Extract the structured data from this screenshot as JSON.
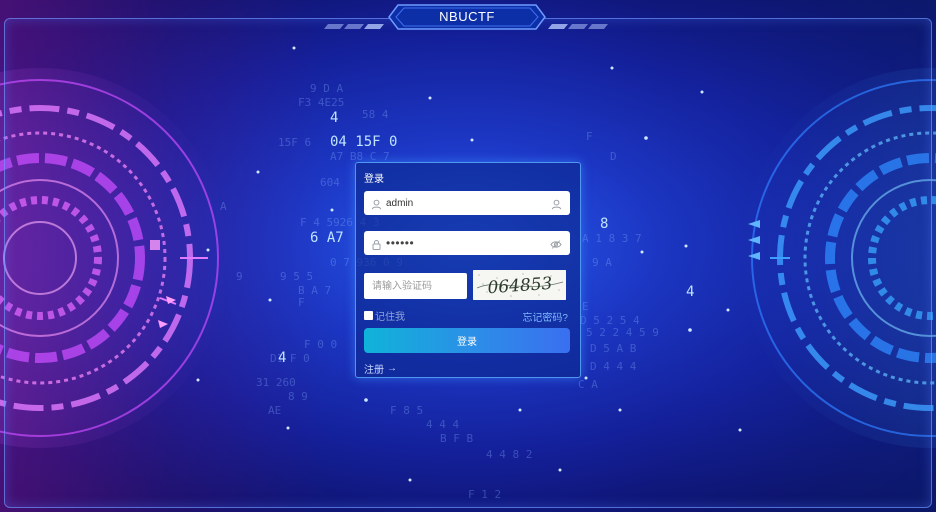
{
  "header": {
    "title": "NBUCTF"
  },
  "login": {
    "panel_title": "登录",
    "username": {
      "value": "admin",
      "icon": "user-icon",
      "trailing_icon": "user-icon"
    },
    "password": {
      "masked_value": "••••••",
      "icon": "lock-icon",
      "trailing_icon": "eye-icon"
    },
    "captcha": {
      "placeholder": "请输入验证码",
      "image_text": "064853"
    },
    "remember_label": "记住我",
    "forgot_label": "忘记密码?",
    "submit_label": "登录",
    "register_label": "注册",
    "register_icon": "arrow-right-icon"
  },
  "colors": {
    "accent": "#2d8de8",
    "panel_border": "#5aaaff",
    "link": "#7fb8ff"
  }
}
